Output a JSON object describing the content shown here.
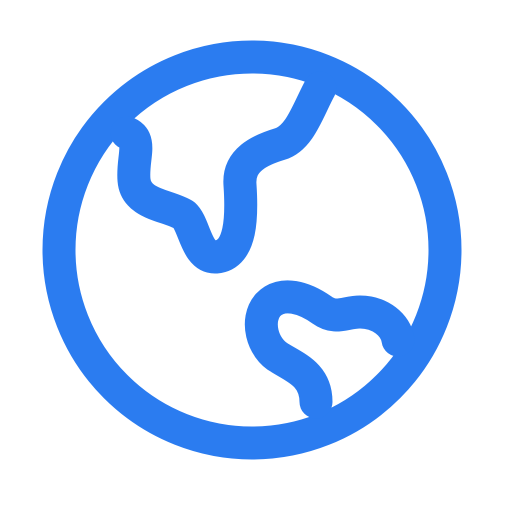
{
  "icon": {
    "name": "globe-icon",
    "color": "#2b7cf0",
    "background": "#ffffff"
  }
}
